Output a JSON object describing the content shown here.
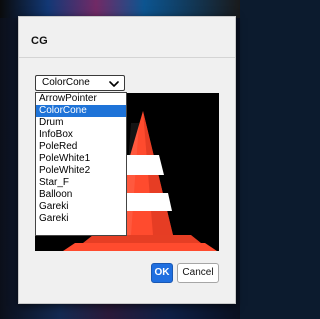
{
  "dialog": {
    "title": "CG",
    "select": {
      "value": "ColorCone",
      "options": [
        "ArrowPointer",
        "ColorCone",
        "Drum",
        "InfoBox",
        "PoleRed",
        "PoleWhite1",
        "PoleWhite2",
        "Star_F",
        "Balloon",
        "Gareki",
        "Gareki"
      ],
      "selected_index": 1
    },
    "buttons": {
      "ok": "OK",
      "cancel": "Cancel"
    },
    "colors": {
      "dialog_bg": "#f0f0f0",
      "accent_blue": "#1f6fe0",
      "selection_blue": "#1e73d8",
      "cone_orange": "#ff4b2e",
      "cone_white": "#ffffff"
    }
  }
}
